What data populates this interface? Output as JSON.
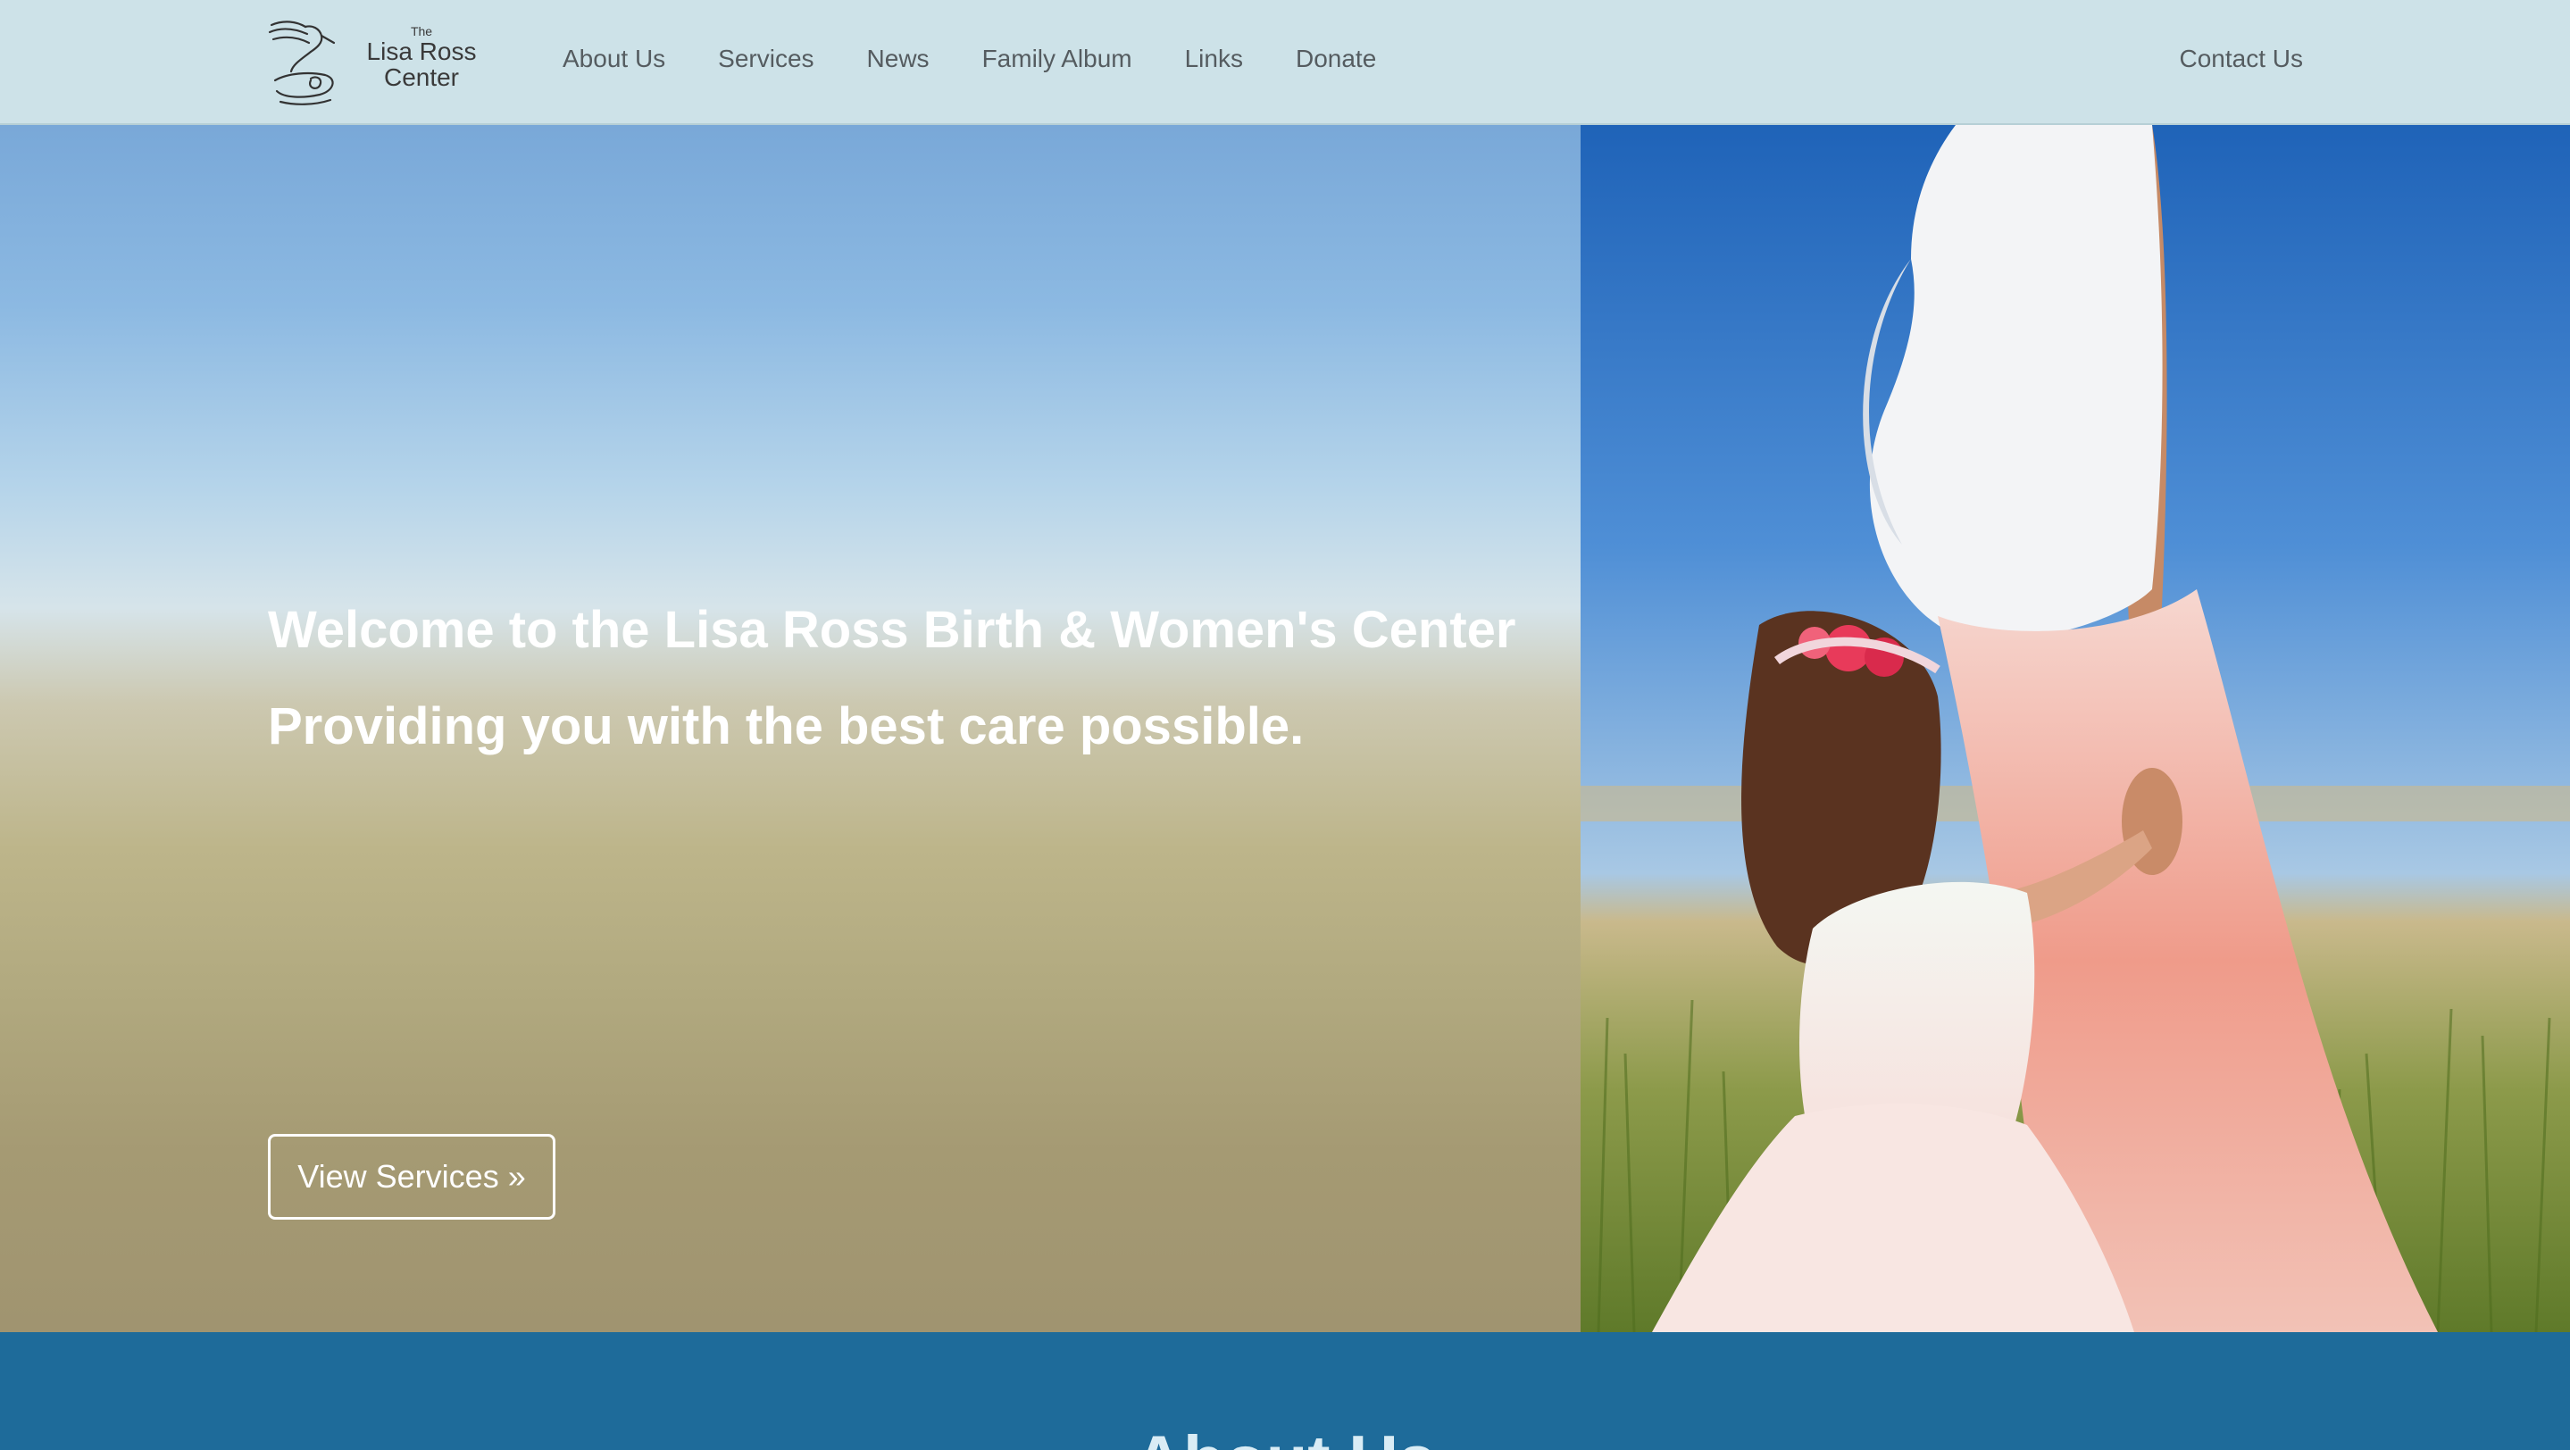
{
  "header": {
    "logo": {
      "the": "The",
      "line1": "Lisa Ross",
      "line2": "Center"
    },
    "nav": [
      {
        "label": "About Us"
      },
      {
        "label": "Services"
      },
      {
        "label": "News"
      },
      {
        "label": "Family Album"
      },
      {
        "label": "Links"
      },
      {
        "label": "Donate"
      }
    ],
    "contact_label": "Contact Us"
  },
  "hero": {
    "title": "Welcome to the Lisa Ross Birth & Women's Center",
    "subtitle": "Providing you with the best care possible.",
    "cta_label": "View Services »"
  },
  "about": {
    "heading": "About Us"
  },
  "colors": {
    "header_bg": "#cde2e8",
    "nav_text": "#555c60",
    "about_bg": "#1e6b9a",
    "hero_text": "#ffffff"
  }
}
